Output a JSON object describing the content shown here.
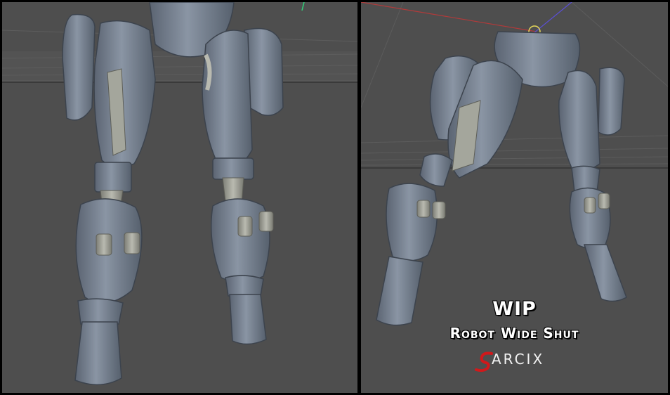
{
  "caption": {
    "status": "WIP",
    "title": "Robot Wide Shut"
  },
  "logo": {
    "text": "ARCIX",
    "mark_color": "#d0191b"
  },
  "viewports": {
    "left": {
      "view": "front-view-legs"
    },
    "right": {
      "view": "perspective-view-legs"
    }
  },
  "colors": {
    "model": "#7f8a99",
    "background": "#4e4e4e",
    "grid": "#5a5a5a",
    "joints": "#a9aa9f"
  }
}
